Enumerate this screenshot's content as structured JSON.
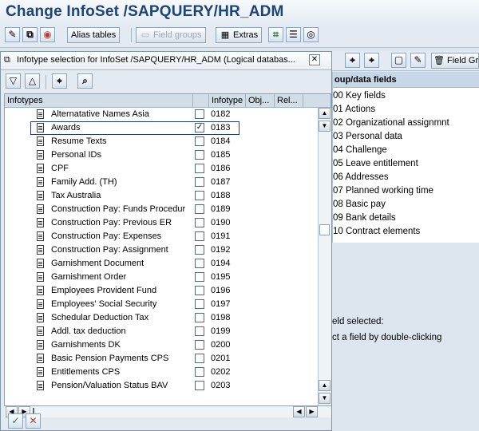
{
  "window": {
    "title": "Change InfoSet /SAPQUERY/HR_ADM"
  },
  "app_toolbar": {
    "alias_tables": "Alias tables",
    "field_groups": "Field groups",
    "extras": "Extras"
  },
  "background": {
    "toolbar_field_group_label": "Field Grou",
    "panel_header": "oup/data fields",
    "rows": [
      "00 Key fields",
      "01 Actions",
      "02 Organizational assignmnt",
      "03 Personal data",
      "04 Challenge",
      "05 Leave entitlement",
      "06 Addresses",
      "07 Planned working time",
      "08 Basic pay",
      "09 Bank details",
      "10 Contract elements"
    ],
    "status_line1": "eld selected:",
    "status_line2": "ct a field by double-clicking"
  },
  "dialog": {
    "title": "Infotype selection for InfoSet /SAPQUERY/HR_ADM (Logical databas...",
    "columns": {
      "infotypes": "Infotypes",
      "infotype": "Infotype",
      "obj": "Obj...",
      "rel": "Rel..."
    },
    "rows": [
      {
        "name": "Alternatative Names Asia",
        "code": "0182",
        "checked": ""
      },
      {
        "name": "Awards",
        "code": "0183",
        "checked": "✓"
      },
      {
        "name": "Resume Texts",
        "code": "0184",
        "checked": ""
      },
      {
        "name": "Personal IDs",
        "code": "0185",
        "checked": ""
      },
      {
        "name": "CPF",
        "code": "0186",
        "checked": ""
      },
      {
        "name": "Family Add. (TH)",
        "code": "0187",
        "checked": ""
      },
      {
        "name": "Tax Australia",
        "code": "0188",
        "checked": ""
      },
      {
        "name": "Construction Pay: Funds Procedur",
        "code": "0189",
        "checked": ""
      },
      {
        "name": "Construction Pay: Previous ER",
        "code": "0190",
        "checked": ""
      },
      {
        "name": "Construction Pay: Expenses",
        "code": "0191",
        "checked": ""
      },
      {
        "name": "Construction Pay: Assignment",
        "code": "0192",
        "checked": ""
      },
      {
        "name": "Garnishment Document",
        "code": "0194",
        "checked": ""
      },
      {
        "name": "Garnishment Order",
        "code": "0195",
        "checked": ""
      },
      {
        "name": "Employees Provident Fund",
        "code": "0196",
        "checked": ""
      },
      {
        "name": "Employees' Social Security",
        "code": "0197",
        "checked": ""
      },
      {
        "name": "Schedular Deduction Tax",
        "code": "0198",
        "checked": ""
      },
      {
        "name": "Addl. tax deduction",
        "code": "0199",
        "checked": ""
      },
      {
        "name": "Garnishments  DK",
        "code": "0200",
        "checked": ""
      },
      {
        "name": "Basic Pension Payments CPS",
        "code": "0201",
        "checked": ""
      },
      {
        "name": "Entitlements CPS",
        "code": "0202",
        "checked": ""
      },
      {
        "name": "Pension/Valuation Status BAV",
        "code": "0203",
        "checked": ""
      }
    ]
  }
}
